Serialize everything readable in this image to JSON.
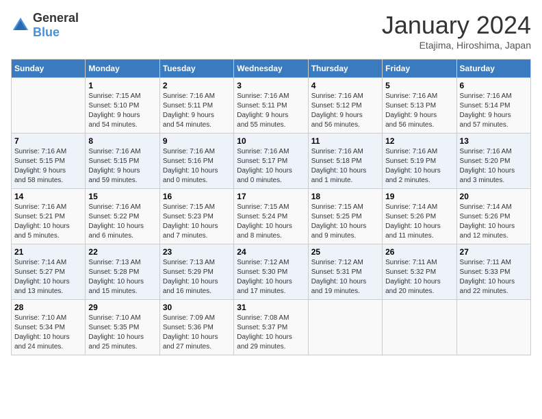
{
  "logo": {
    "general": "General",
    "blue": "Blue"
  },
  "header": {
    "title": "January 2024",
    "subtitle": "Etajima, Hiroshima, Japan"
  },
  "days_of_week": [
    "Sunday",
    "Monday",
    "Tuesday",
    "Wednesday",
    "Thursday",
    "Friday",
    "Saturday"
  ],
  "weeks": [
    [
      {
        "day": "",
        "info": ""
      },
      {
        "day": "1",
        "info": "Sunrise: 7:15 AM\nSunset: 5:10 PM\nDaylight: 9 hours\nand 54 minutes."
      },
      {
        "day": "2",
        "info": "Sunrise: 7:16 AM\nSunset: 5:11 PM\nDaylight: 9 hours\nand 54 minutes."
      },
      {
        "day": "3",
        "info": "Sunrise: 7:16 AM\nSunset: 5:11 PM\nDaylight: 9 hours\nand 55 minutes."
      },
      {
        "day": "4",
        "info": "Sunrise: 7:16 AM\nSunset: 5:12 PM\nDaylight: 9 hours\nand 56 minutes."
      },
      {
        "day": "5",
        "info": "Sunrise: 7:16 AM\nSunset: 5:13 PM\nDaylight: 9 hours\nand 56 minutes."
      },
      {
        "day": "6",
        "info": "Sunrise: 7:16 AM\nSunset: 5:14 PM\nDaylight: 9 hours\nand 57 minutes."
      }
    ],
    [
      {
        "day": "7",
        "info": "Sunrise: 7:16 AM\nSunset: 5:15 PM\nDaylight: 9 hours\nand 58 minutes."
      },
      {
        "day": "8",
        "info": "Sunrise: 7:16 AM\nSunset: 5:15 PM\nDaylight: 9 hours\nand 59 minutes."
      },
      {
        "day": "9",
        "info": "Sunrise: 7:16 AM\nSunset: 5:16 PM\nDaylight: 10 hours\nand 0 minutes."
      },
      {
        "day": "10",
        "info": "Sunrise: 7:16 AM\nSunset: 5:17 PM\nDaylight: 10 hours\nand 0 minutes."
      },
      {
        "day": "11",
        "info": "Sunrise: 7:16 AM\nSunset: 5:18 PM\nDaylight: 10 hours\nand 1 minute."
      },
      {
        "day": "12",
        "info": "Sunrise: 7:16 AM\nSunset: 5:19 PM\nDaylight: 10 hours\nand 2 minutes."
      },
      {
        "day": "13",
        "info": "Sunrise: 7:16 AM\nSunset: 5:20 PM\nDaylight: 10 hours\nand 3 minutes."
      }
    ],
    [
      {
        "day": "14",
        "info": "Sunrise: 7:16 AM\nSunset: 5:21 PM\nDaylight: 10 hours\nand 5 minutes."
      },
      {
        "day": "15",
        "info": "Sunrise: 7:16 AM\nSunset: 5:22 PM\nDaylight: 10 hours\nand 6 minutes."
      },
      {
        "day": "16",
        "info": "Sunrise: 7:15 AM\nSunset: 5:23 PM\nDaylight: 10 hours\nand 7 minutes."
      },
      {
        "day": "17",
        "info": "Sunrise: 7:15 AM\nSunset: 5:24 PM\nDaylight: 10 hours\nand 8 minutes."
      },
      {
        "day": "18",
        "info": "Sunrise: 7:15 AM\nSunset: 5:25 PM\nDaylight: 10 hours\nand 9 minutes."
      },
      {
        "day": "19",
        "info": "Sunrise: 7:14 AM\nSunset: 5:26 PM\nDaylight: 10 hours\nand 11 minutes."
      },
      {
        "day": "20",
        "info": "Sunrise: 7:14 AM\nSunset: 5:26 PM\nDaylight: 10 hours\nand 12 minutes."
      }
    ],
    [
      {
        "day": "21",
        "info": "Sunrise: 7:14 AM\nSunset: 5:27 PM\nDaylight: 10 hours\nand 13 minutes."
      },
      {
        "day": "22",
        "info": "Sunrise: 7:13 AM\nSunset: 5:28 PM\nDaylight: 10 hours\nand 15 minutes."
      },
      {
        "day": "23",
        "info": "Sunrise: 7:13 AM\nSunset: 5:29 PM\nDaylight: 10 hours\nand 16 minutes."
      },
      {
        "day": "24",
        "info": "Sunrise: 7:12 AM\nSunset: 5:30 PM\nDaylight: 10 hours\nand 17 minutes."
      },
      {
        "day": "25",
        "info": "Sunrise: 7:12 AM\nSunset: 5:31 PM\nDaylight: 10 hours\nand 19 minutes."
      },
      {
        "day": "26",
        "info": "Sunrise: 7:11 AM\nSunset: 5:32 PM\nDaylight: 10 hours\nand 20 minutes."
      },
      {
        "day": "27",
        "info": "Sunrise: 7:11 AM\nSunset: 5:33 PM\nDaylight: 10 hours\nand 22 minutes."
      }
    ],
    [
      {
        "day": "28",
        "info": "Sunrise: 7:10 AM\nSunset: 5:34 PM\nDaylight: 10 hours\nand 24 minutes."
      },
      {
        "day": "29",
        "info": "Sunrise: 7:10 AM\nSunset: 5:35 PM\nDaylight: 10 hours\nand 25 minutes."
      },
      {
        "day": "30",
        "info": "Sunrise: 7:09 AM\nSunset: 5:36 PM\nDaylight: 10 hours\nand 27 minutes."
      },
      {
        "day": "31",
        "info": "Sunrise: 7:08 AM\nSunset: 5:37 PM\nDaylight: 10 hours\nand 29 minutes."
      },
      {
        "day": "",
        "info": ""
      },
      {
        "day": "",
        "info": ""
      },
      {
        "day": "",
        "info": ""
      }
    ]
  ]
}
